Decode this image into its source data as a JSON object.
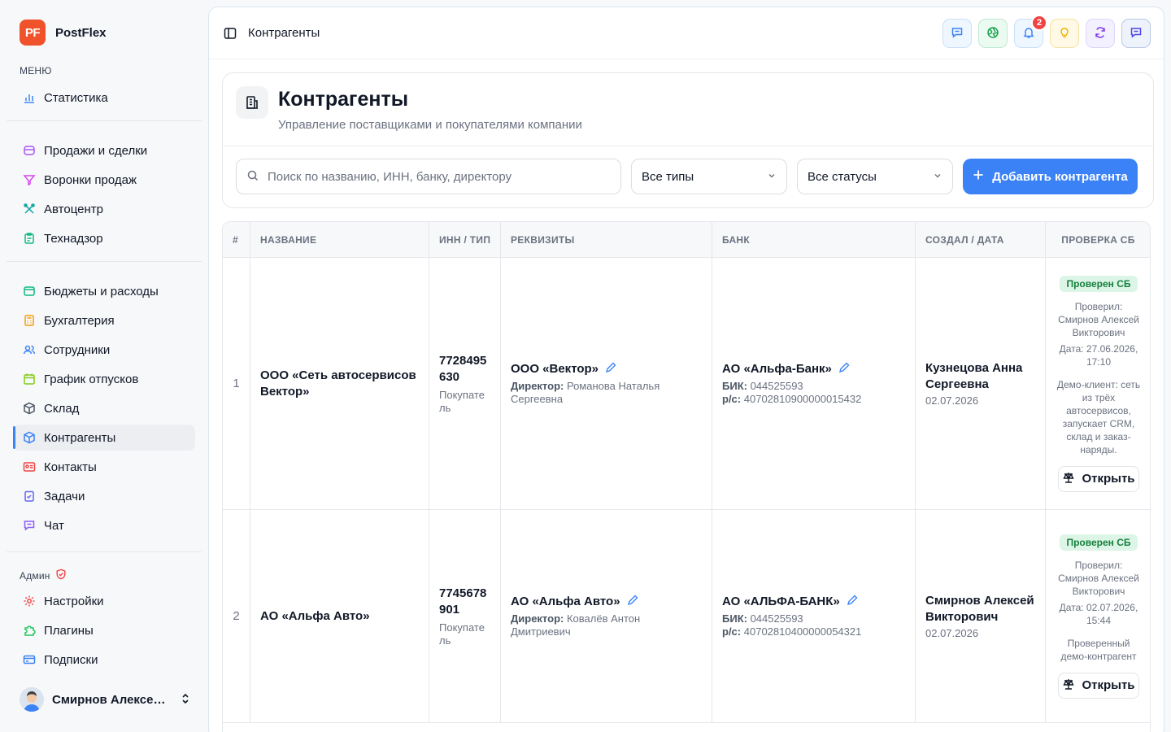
{
  "brand": {
    "logo": "PF",
    "name": "PostFlex",
    "logo_color": "#f0522b"
  },
  "sidebar": {
    "menu_caption": "МЕНЮ",
    "admin_caption": "Админ",
    "items": [
      {
        "label": "Статистика",
        "icon": "bar-chart-icon"
      },
      {
        "label": "Продажи и сделки",
        "icon": "cart-icon"
      },
      {
        "label": "Воронки продаж",
        "icon": "funnel-icon"
      },
      {
        "label": "Автоцентр",
        "icon": "wrench-icon"
      },
      {
        "label": "Технадзор",
        "icon": "clipboard-icon"
      },
      {
        "label": "Бюджеты и расходы",
        "icon": "wallet-icon"
      },
      {
        "label": "Бухгалтерия",
        "icon": "calculator-icon"
      },
      {
        "label": "Сотрудники",
        "icon": "users-icon"
      },
      {
        "label": "График отпусков",
        "icon": "calendar-icon"
      },
      {
        "label": "Склад",
        "icon": "box-icon"
      },
      {
        "label": "Контрагенты",
        "icon": "cube-icon"
      },
      {
        "label": "Контакты",
        "icon": "contact-card-icon"
      },
      {
        "label": "Задачи",
        "icon": "tasks-icon"
      },
      {
        "label": "Чат",
        "icon": "chat-icon"
      },
      {
        "label": "Настройки",
        "icon": "gear-icon"
      },
      {
        "label": "Плагины",
        "icon": "puzzle-icon"
      },
      {
        "label": "Подписки",
        "icon": "credit-card-icon"
      }
    ],
    "active": "Контрагенты",
    "user_name": "Смирнов Алексей ..."
  },
  "topbar": {
    "title": "Контрагенты",
    "notification_count": "2"
  },
  "page": {
    "title": "Контрагенты",
    "subtitle": "Управление поставщиками и покупателями компании",
    "search_placeholder": "Поиск по названию, ИНН, банку, директору",
    "type_filter": "Все типы",
    "status_filter": "Все статусы",
    "add_button": "Добавить контрагента"
  },
  "table": {
    "headers": [
      "#",
      "НАЗВАНИЕ",
      "ИНН / ТИП",
      "РЕКВИЗИТЫ",
      "БАНК",
      "СОЗДАЛ / ДАТА",
      "ПРОВЕРКА СБ"
    ],
    "director_label": "Директор:",
    "bik_label": "БИК:",
    "account_label": "р/с:",
    "rows": [
      {
        "num": "1",
        "name": "ООО «Сеть автосервисов Вектор»",
        "inn": "7728495630",
        "type": "Покупатель",
        "req_name": "ООО «Вектор»",
        "director": "Романова Наталья Сергеевна",
        "bank": "АО «Альфа-Банк»",
        "bik": "044525593",
        "account": "40702810900000015432",
        "creator": "Кузнецова Анна Сергеевна",
        "created": "02.07.2026",
        "sb_status": "Проверен СБ",
        "sb_checked_by": "Проверил: Смирнов Алексей Викторович",
        "sb_date": "Дата: 27.06.2026, 17:10",
        "sb_note": "Демо-клиент: сеть из трёх автосервисов, запускает CRM, склад и заказ-наряды.",
        "open_label": "Открыть"
      },
      {
        "num": "2",
        "name": "АО «Альфа Авто»",
        "inn": "7745678901",
        "type": "Покупатель",
        "req_name": "АО «Альфа Авто»",
        "director": "Ковалёв Антон Дмитриевич",
        "bank": "АО «АЛЬФА-БАНК»",
        "bik": "044525593",
        "account": "40702810400000054321",
        "creator": "Смирнов Алексей Викторович",
        "created": "02.07.2026",
        "sb_status": "Проверен СБ",
        "sb_checked_by": "Проверил: Смирнов Алексей Викторович",
        "sb_date": "Дата: 02.07.2026, 15:44",
        "sb_note": "Проверенный демо-контрагент",
        "open_label": "Открыть"
      }
    ]
  },
  "colors": {
    "accent": "#3b82f6",
    "badge_red": "#ef4444",
    "verified_green": "#15803d"
  }
}
